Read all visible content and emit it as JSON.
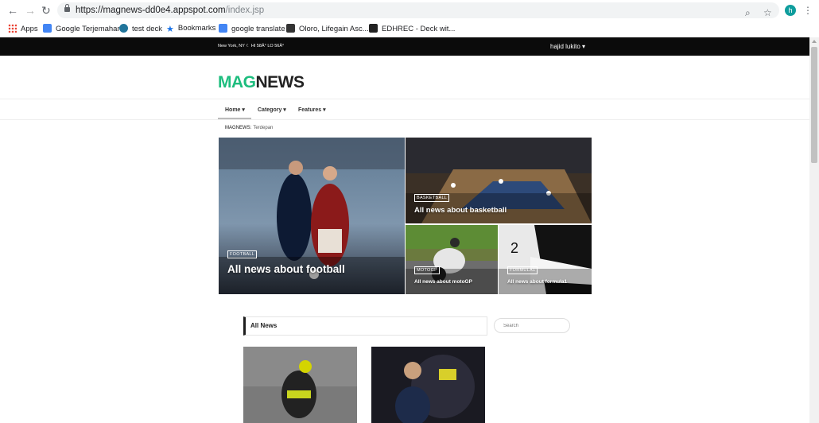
{
  "browser": {
    "url_host": "https://magnews-dd0e4.appspot.com",
    "url_path": "/index.jsp",
    "profile_initial": "h",
    "bookmarks": [
      {
        "label": "Apps"
      },
      {
        "label": "Google Terjemahan"
      },
      {
        "label": "test deck"
      },
      {
        "label": "Bookmarks"
      },
      {
        "label": "google translate"
      },
      {
        "label": "Oloro, Lifegain Asc..."
      },
      {
        "label": "EDHREC - Deck wit..."
      }
    ]
  },
  "topbar": {
    "weather": "New York, NY  ☾  HI 58Â° LO 56Â°",
    "user": "hajid lukito ▾"
  },
  "logo": {
    "part1": "MAG",
    "part2": "NEWS"
  },
  "menu": {
    "items": [
      {
        "label": "Home ▾"
      },
      {
        "label": "Category ▾"
      },
      {
        "label": "Features ▾"
      }
    ]
  },
  "ticker": {
    "label": "MAGNEWS:",
    "text": "Terdepan"
  },
  "featured": [
    {
      "tag": "FOOTBALL",
      "title": "All news about football"
    },
    {
      "tag": "BASKETBALL",
      "title": "All news about basketball"
    },
    {
      "tag": "MOTOGP",
      "title": "All news about motoGP"
    },
    {
      "tag": "FORMULA1",
      "title": "All news about formula1"
    }
  ],
  "section": {
    "title": "All News",
    "search_placeholder": "Search"
  },
  "colors": {
    "brand_green": "#1dbd7e",
    "topbar": "#0b0b0b"
  }
}
